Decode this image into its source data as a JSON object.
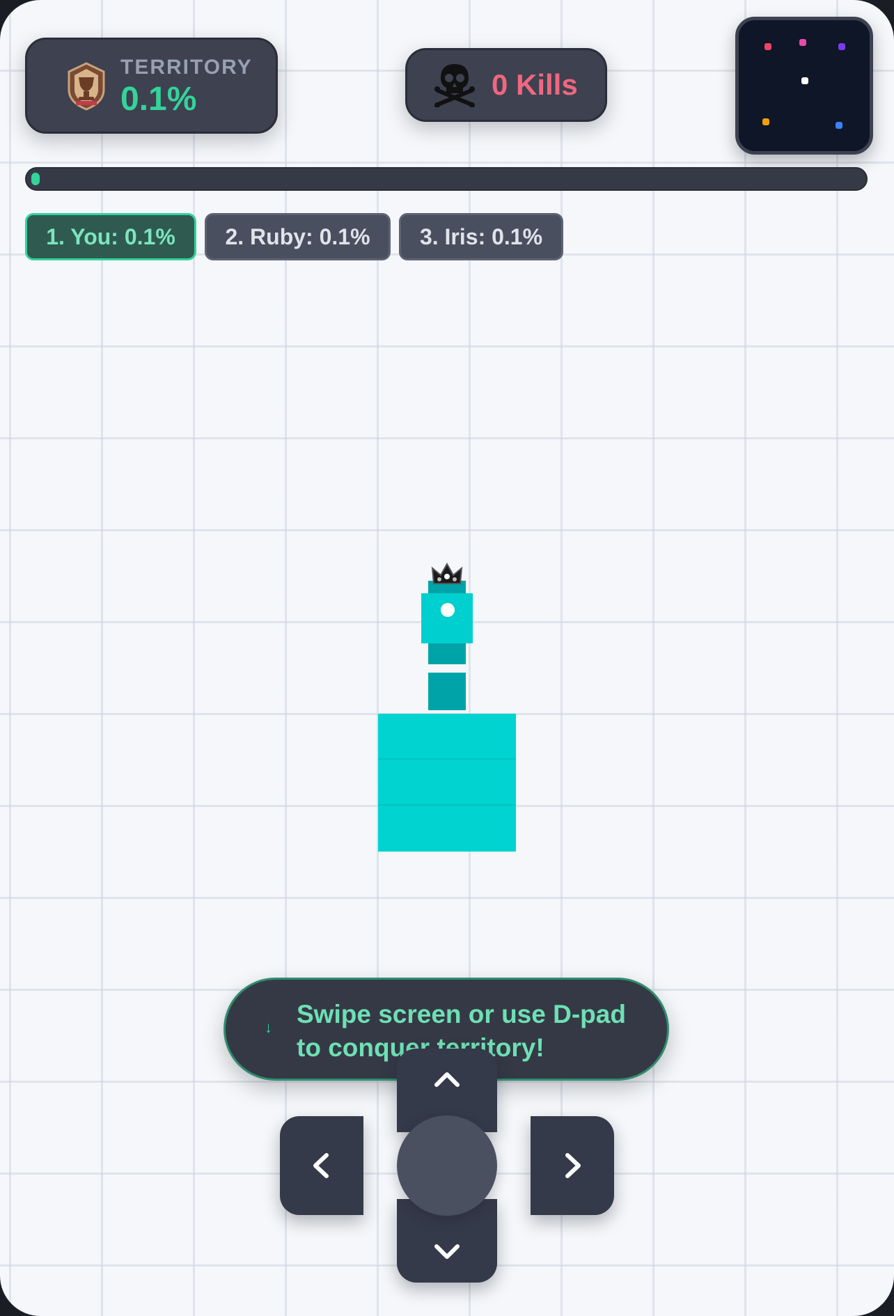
{
  "hud": {
    "territory_label": "TERRITORY",
    "territory_value": "0.1%",
    "kills_count": "0",
    "kills_label": "Kills"
  },
  "progress": {
    "fraction": 0.001
  },
  "leaderboard": [
    {
      "label": "1. You: 0.1%"
    },
    {
      "label": "2. Ruby: 0.1%"
    },
    {
      "label": "3. Iris: 0.1%"
    }
  ],
  "minimap": {
    "players": [
      {
        "color": "#ef4565"
      },
      {
        "color": "#e94aa8"
      },
      {
        "color": "#7c3aed"
      },
      {
        "color": "#ffffff"
      },
      {
        "color": "#f59e0b"
      },
      {
        "color": "#3b82f6"
      }
    ]
  },
  "hint": {
    "arrow": "↓",
    "text": "Swipe screen or use D-pad to conquer territory!"
  },
  "colors": {
    "player": "#00d3d0",
    "trail": "#00a4a8",
    "accent": "#34d39a",
    "kills": "#f0677f"
  },
  "icons": {
    "territory": "trophy-emblem-icon",
    "kills": "skull-crossbones-icon",
    "player_crown": "crown-icon",
    "dpad": [
      "chevron-up-icon",
      "chevron-down-icon",
      "chevron-left-icon",
      "chevron-right-icon"
    ]
  }
}
